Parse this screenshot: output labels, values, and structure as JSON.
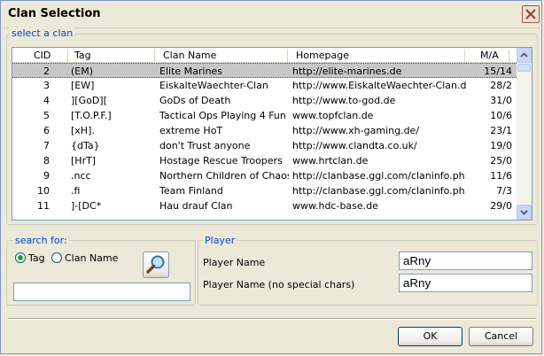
{
  "window": {
    "title": "Clan Selection"
  },
  "clan_group": {
    "legend": "select a clan"
  },
  "table": {
    "columns": [
      "CID",
      "Tag",
      "Clan Name",
      "Homepage",
      "M/A"
    ],
    "rows": [
      {
        "cid": "2",
        "tag": "(EM)",
        "name": "Elite Marines",
        "homepage": "http://elite-marines.de",
        "ma": "15/14",
        "selected": true
      },
      {
        "cid": "3",
        "tag": "[EW]",
        "name": "EiskalteWaechter-Clan",
        "homepage": "http://www.EiskalteWaechter-Clan.de",
        "ma": "28/2"
      },
      {
        "cid": "4",
        "tag": "][GoD][",
        "name": "GoDs of Death",
        "homepage": "http://www.to-god.de",
        "ma": "31/0"
      },
      {
        "cid": "5",
        "tag": "[T.O.P.F.]",
        "name": "Tactical Ops Playing 4 Fun",
        "homepage": "www.topfclan.de",
        "ma": "10/6"
      },
      {
        "cid": "6",
        "tag": "[xH].",
        "name": "extreme HoT",
        "homepage": "http://www.xh-gaming.de/",
        "ma": "23/1"
      },
      {
        "cid": "7",
        "tag": "{dTa}",
        "name": "don't Trust anyone",
        "homepage": "http://www.clandta.co.uk/",
        "ma": "19/0"
      },
      {
        "cid": "8",
        "tag": "[HrT]",
        "name": "Hostage Rescue Troopers",
        "homepage": "www.hrtclan.de",
        "ma": "25/0"
      },
      {
        "cid": "9",
        "tag": ".ncc",
        "name": "Northern Children of Chaos",
        "homepage": "http://clanbase.ggl.com/claninfo.ph...",
        "ma": "11/6"
      },
      {
        "cid": "10",
        "tag": ".fi",
        "name": "Team Finland",
        "homepage": "http://clanbase.ggl.com/claninfo.ph...",
        "ma": "7/3"
      },
      {
        "cid": "11",
        "tag": "]-[DC*",
        "name": "Hau drauf Clan",
        "homepage": "www.hdc-base.de",
        "ma": "29/0"
      }
    ]
  },
  "search": {
    "legend": "search for:",
    "options": [
      "Tag",
      "Clan Name"
    ],
    "selected": "Tag",
    "value": ""
  },
  "player": {
    "legend": "Player",
    "name_label": "Player Name",
    "name_value": "aRny",
    "nospecial_label": "Player Name (no special chars)",
    "nospecial_value": "aRny"
  },
  "buttons": {
    "ok": "OK",
    "cancel": "Cancel"
  },
  "colors": {
    "legend": "#0046D5",
    "selection": "#C7C7C7",
    "border": "#7F9DB9"
  }
}
